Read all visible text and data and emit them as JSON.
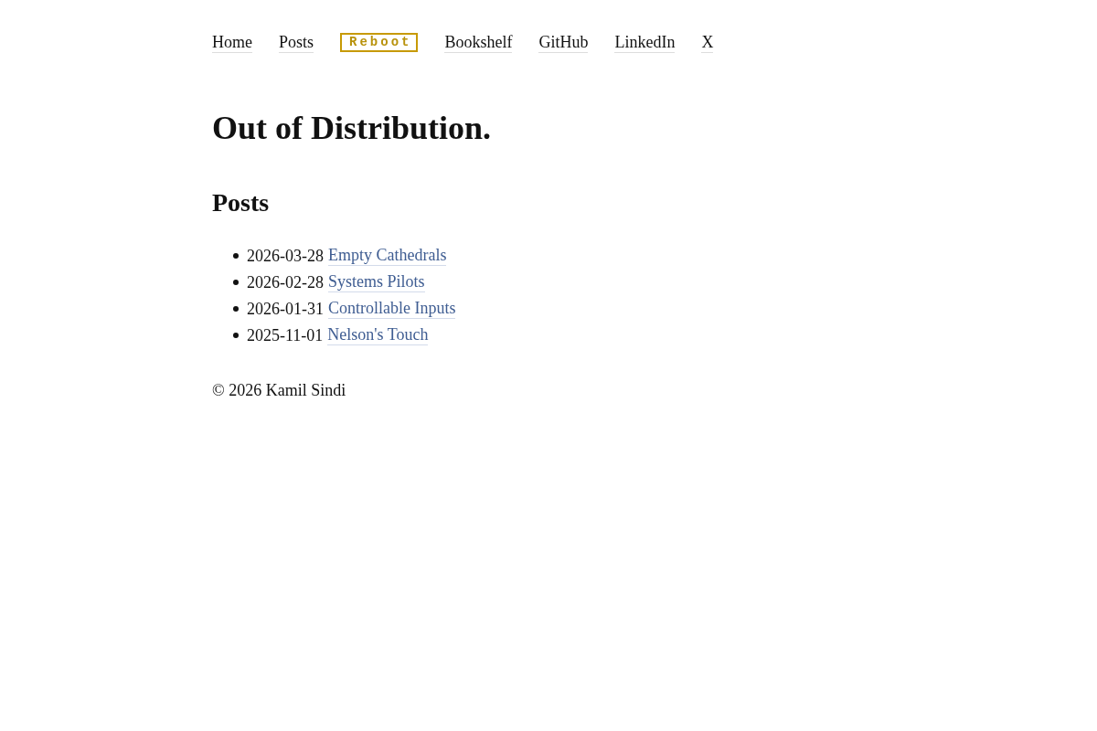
{
  "nav": [
    {
      "label": "Home",
      "kind": "link"
    },
    {
      "label": "Posts",
      "kind": "link"
    },
    {
      "label": "Reboot",
      "kind": "badge"
    },
    {
      "label": "Bookshelf",
      "kind": "link"
    },
    {
      "label": "GitHub",
      "kind": "link"
    },
    {
      "label": "LinkedIn",
      "kind": "link"
    },
    {
      "label": "X",
      "kind": "link"
    }
  ],
  "site_title": "Out of Distribution.",
  "section_heading": "Posts",
  "posts": [
    {
      "date": "2026-03-28",
      "title": "Empty Cathedrals"
    },
    {
      "date": "2026-02-28",
      "title": "Systems Pilots"
    },
    {
      "date": "2026-01-31",
      "title": "Controllable Inputs"
    },
    {
      "date": "2025-11-01",
      "title": "Nelson's Touch"
    }
  ],
  "footer": "© 2026 Kamil Sindi"
}
